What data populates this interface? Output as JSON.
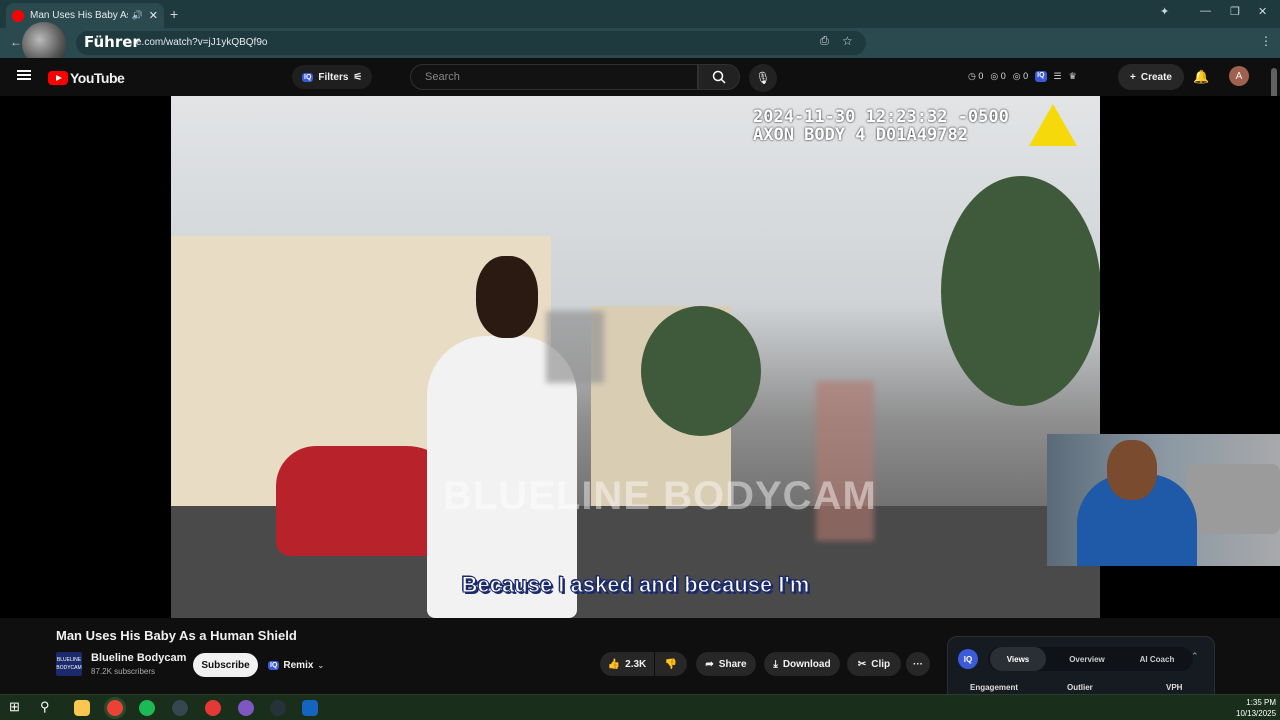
{
  "browser": {
    "tab_title": "Man Uses His Baby As a Hu",
    "url": "e.com/watch?v=jJ1ykQBQf9o",
    "overlay_name": "Führer"
  },
  "header": {
    "logo_text": "YouTube",
    "filters_label": "Filters",
    "search_placeholder": "Search",
    "stats": [
      "0",
      "0",
      "0"
    ],
    "create_label": "Create",
    "avatar_letter": "A"
  },
  "video": {
    "timestamp_line1": "2024-11-30 12:23:32 -0500",
    "timestamp_line2": "AXON BODY 4 D01A49782",
    "watermark": "BLUELINE BODYCAM",
    "subtitle": "Because I asked and because I'm"
  },
  "info": {
    "title": "Man Uses His Baby As a Human Shield",
    "channel_name": "Blueline Bodycam",
    "channel_logo_text": "BLUELINE BODYCAM",
    "subscribers": "87.2K subscribers",
    "subscribe_label": "Subscribe",
    "remix_label": "Remix",
    "likes": "2.3K",
    "share_label": "Share",
    "download_label": "Download",
    "clip_label": "Clip",
    "more_label": "···"
  },
  "iq_panel": {
    "logo": "IQ",
    "tabs": [
      "Views",
      "Overview",
      "AI Coach"
    ],
    "columns": [
      "Engagement",
      "Outlier",
      "VPH"
    ]
  },
  "taskbar": {
    "time": "1:35 PM",
    "date": "10/13/2025"
  },
  "colors": {
    "accent_red": "#ff0000",
    "iq_blue": "#3b5bdb",
    "browser_teal": "#2b4a50"
  }
}
